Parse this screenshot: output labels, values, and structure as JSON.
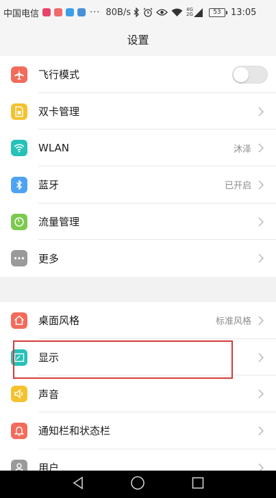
{
  "status_bar": {
    "carrier": "中国电信",
    "app_icon_colors": [
      "#e8436b",
      "#f06a6a",
      "#3aa0e8",
      "#4a90d9"
    ],
    "more_indicator": "···",
    "net_speed": "80B/s",
    "network_top": "4G",
    "network_bottom": "2G",
    "battery": "53",
    "time": "13:05"
  },
  "header": {
    "title": "设置"
  },
  "groups": [
    {
      "items": [
        {
          "key": "airplane",
          "label": "飞行模式",
          "icon": "airplane-icon",
          "color": "#f26b5b",
          "control": "toggle",
          "toggle_on": false
        },
        {
          "key": "dual-sim",
          "label": "双卡管理",
          "icon": "sim-card-icon",
          "color": "#f5c22f",
          "control": "chevron"
        },
        {
          "key": "wlan",
          "label": "WLAN",
          "value": "沐泽",
          "icon": "wifi-icon",
          "color": "#26c1b8",
          "control": "chevron"
        },
        {
          "key": "bluetooth",
          "label": "蓝牙",
          "value": "已开启",
          "icon": "bluetooth-icon",
          "color": "#4da3f2",
          "control": "chevron"
        },
        {
          "key": "data-usage",
          "label": "流量管理",
          "icon": "gauge-icon",
          "color": "#7cc94f",
          "control": "chevron"
        },
        {
          "key": "more",
          "label": "更多",
          "icon": "more-icon",
          "color": "#9a9a9a",
          "control": "chevron"
        }
      ]
    },
    {
      "items": [
        {
          "key": "theme",
          "label": "桌面风格",
          "value": "标准风格",
          "icon": "home-icon",
          "color": "#f26b5b",
          "control": "chevron"
        },
        {
          "key": "display",
          "label": "显示",
          "icon": "display-icon",
          "color": "#26c1b8",
          "control": "chevron"
        },
        {
          "key": "sound",
          "label": "声音",
          "icon": "speaker-icon",
          "color": "#f5c22f",
          "control": "chevron"
        },
        {
          "key": "notifications",
          "label": "通知栏和状态栏",
          "icon": "bell-icon",
          "color": "#f26b5b",
          "control": "chevron"
        },
        {
          "key": "users",
          "label": "用户",
          "icon": "user-icon",
          "color": "#9a9a9a",
          "control": "chevron"
        }
      ]
    }
  ],
  "highlight_color": "#d43a3a",
  "nav_bar": {
    "back_icon": "back-triangle-icon",
    "home_icon": "home-circle-icon",
    "recents_icon": "recents-square-icon"
  }
}
